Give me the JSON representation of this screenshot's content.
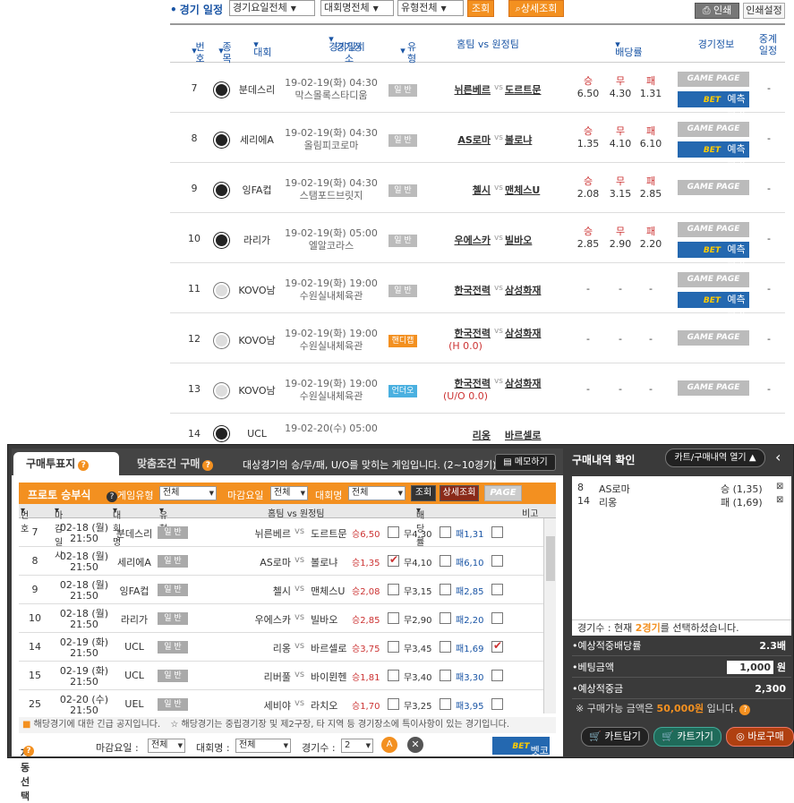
{
  "header": {
    "title": "경기 일정",
    "filters": [
      "경기요일전체",
      "대회명전체",
      "유형전체"
    ],
    "search_btn": "조회",
    "detail_btn": "상세조회",
    "print_btn": "인쇄",
    "print_settings_btn": "인쇄설정"
  },
  "columns": {
    "num": "번호",
    "sport": "종목",
    "league": "대회",
    "datetime": "경기일시",
    "venue": "경기장소",
    "type": "유형",
    "home_vs_away": "홈팀 vs 원정팀",
    "odds": "배당률",
    "info": "경기정보",
    "broadcast": "중계일정"
  },
  "games": [
    {
      "num": "7",
      "league": "분데스리",
      "sport": "soccer",
      "dt": "19-02-19(화) 04:30",
      "venue": "막스몰록스타디움",
      "type": "일 반",
      "type_color": "gray",
      "home": "뉘른베르",
      "away": "도르트문",
      "o1": "6.50",
      "o2": "4.30",
      "o3": "1.31",
      "bet": true,
      "dash": "-"
    },
    {
      "num": "8",
      "league": "세리에A",
      "sport": "soccer",
      "dt": "19-02-19(화) 04:30",
      "venue": "올림피코로마",
      "type": "일 반",
      "type_color": "gray",
      "home": "AS로마",
      "away": "볼로냐",
      "o1": "1.35",
      "o2": "4.10",
      "o3": "6.10",
      "bet": true,
      "dash": "-"
    },
    {
      "num": "9",
      "league": "잉FA컵",
      "sport": "soccer",
      "dt": "19-02-19(화) 04:30",
      "venue": "스탬포드브릿지",
      "type": "일 반",
      "type_color": "gray",
      "home": "첼시",
      "away": "맨체스U",
      "o1": "2.08",
      "o2": "3.15",
      "o3": "2.85",
      "bet": false,
      "dash": "-"
    },
    {
      "num": "10",
      "league": "라리가",
      "sport": "soccer",
      "dt": "19-02-19(화) 05:00",
      "venue": "엘알코라스",
      "type": "일 반",
      "type_color": "gray",
      "home": "우에스카",
      "away": "빌바오",
      "o1": "2.85",
      "o2": "2.90",
      "o3": "2.20",
      "bet": true,
      "dash": "-"
    },
    {
      "num": "11",
      "league": "KOVO남",
      "sport": "volley",
      "dt": "19-02-19(화) 19:00",
      "venue": "수원실내체육관",
      "type": "일 반",
      "type_color": "gray",
      "home": "한국전력",
      "away": "삼성화재",
      "o1": "-",
      "o2": "-",
      "o3": "-",
      "bet": true,
      "dash": "-"
    },
    {
      "num": "12",
      "league": "KOVO남",
      "sport": "volley",
      "dt": "19-02-19(화) 19:00",
      "venue": "수원실내체육관",
      "type": "핸디캡",
      "type_color": "orange",
      "home": "한국전력",
      "away": "삼성화재",
      "extra": "(H 0.0)",
      "o1": "-",
      "o2": "-",
      "o3": "-",
      "bet": false,
      "dash": "-"
    },
    {
      "num": "13",
      "league": "KOVO남",
      "sport": "volley",
      "dt": "19-02-19(화) 19:00",
      "venue": "수원실내체육관",
      "type": "언더오버",
      "type_color": "blue",
      "home": "한국전력",
      "away": "삼성화재",
      "extra": "(U/O 0.0)",
      "o1": "-",
      "o2": "-",
      "o3": "-",
      "bet": false,
      "dash": "-"
    }
  ],
  "partial_row": {
    "num": "14",
    "league": "UCL",
    "dt": "19-02-20(수) 05:00",
    "home": "리옹",
    "away": "바르셀로"
  },
  "odds_labels": {
    "w": "승",
    "d": "무",
    "l": "패"
  },
  "vs": "vs",
  "gamepage": "GAME PAGE",
  "bet_label": "예측하기",
  "bet_tag": "BET",
  "panel": {
    "tab1": "구매투표지",
    "tab2": "맞춤조건 구매",
    "desc": "대상경기의 승/무/패, U/O를 맞히는 게임입니다. (2~10경기)",
    "memo_btn": "메모하기",
    "filter_title": "프로토 승부식",
    "game_type_lbl": "게임유형",
    "game_type_val": "전체",
    "deadline_lbl": "마감요일",
    "deadline_val": "전체",
    "league_lbl": "대회명",
    "league_val": "전체",
    "search_btn": "조회",
    "detail_btn": "상세조회",
    "page_btn": "PAGE",
    "head": {
      "num": "번호",
      "deadline": "마감일시",
      "league": "대회명",
      "type": "유형",
      "teams": "홈팀 vs 원정팀",
      "odds": "배당률",
      "note": "비고"
    },
    "rows": [
      {
        "num": "7",
        "d1": "02-18 (월)",
        "d2": "21:50",
        "league": "분데스리",
        "type": "일 반",
        "home": "뉘른베르",
        "away": "도르트문",
        "w": "승6,50",
        "d": "무4,30",
        "l": "패1,31",
        "cw": false,
        "cd": false,
        "cl": false
      },
      {
        "num": "8",
        "d1": "02-18 (월)",
        "d2": "21:50",
        "league": "세리에A",
        "type": "일 반",
        "home": "AS로마",
        "away": "볼로냐",
        "w": "승1,35",
        "d": "무4,10",
        "l": "패6,10",
        "cw": true,
        "cd": false,
        "cl": false
      },
      {
        "num": "9",
        "d1": "02-18 (월)",
        "d2": "21:50",
        "league": "잉FA컵",
        "type": "일 반",
        "home": "첼시",
        "away": "맨체스U",
        "w": "승2,08",
        "d": "무3,15",
        "l": "패2,85",
        "cw": false,
        "cd": false,
        "cl": false
      },
      {
        "num": "10",
        "d1": "02-18 (월)",
        "d2": "21:50",
        "league": "라리가",
        "type": "일 반",
        "home": "우에스카",
        "away": "빌바오",
        "w": "승2,85",
        "d": "무2,90",
        "l": "패2,20",
        "cw": false,
        "cd": false,
        "cl": false
      },
      {
        "num": "14",
        "d1": "02-19 (화)",
        "d2": "21:50",
        "league": "UCL",
        "type": "일 반",
        "home": "리옹",
        "away": "바르셀로",
        "w": "승3,75",
        "d": "무3,45",
        "l": "패1,69",
        "cw": false,
        "cd": false,
        "cl": true
      },
      {
        "num": "15",
        "d1": "02-19 (화)",
        "d2": "21:50",
        "league": "UCL",
        "type": "일 반",
        "home": "리버풀",
        "away": "바이뮌헨",
        "w": "승1,81",
        "d": "무3,40",
        "l": "패3,30",
        "cw": false,
        "cd": false,
        "cl": false
      },
      {
        "num": "25",
        "d1": "02-20 (수)",
        "d2": "21:50",
        "league": "UEL",
        "type": "일 반",
        "home": "세비야",
        "away": "라치오",
        "w": "승1,70",
        "d": "무3,25",
        "l": "패3,95",
        "cw": false,
        "cd": false,
        "cl": false
      }
    ],
    "notice1": "해당경기에 대한 긴급 공지입니다.",
    "notice2": "해당경기는 중립경기장 및 제2구장, 타 지역 등 경기장소에 특이사항이 있는 경기입니다.",
    "auto_lbl": "자동선택",
    "auto_deadline_lbl": "마감요일 :",
    "auto_deadline_val": "전체",
    "auto_league_lbl": "대회명 :",
    "auto_league_val": "전체",
    "auto_count_lbl": "경기수 :",
    "auto_count_val": "2",
    "bet_btn": "벳코치",
    "right": {
      "title": "구매내역 확인",
      "cart_btn": "카트/구매내역 열기",
      "items": [
        {
          "num": "8",
          "team": "AS로마",
          "odd": "승 (1,35)"
        },
        {
          "num": "14",
          "team": "리옹",
          "odd": "패 (1,69)"
        }
      ],
      "count_text1": "경기수 : 현재 ",
      "count_val": "2경기",
      "count_text2": "를 선택하셨습니다.",
      "exp_odds_lbl": "•예상적중배당률",
      "exp_odds_val": "2.3배",
      "bet_amt_lbl": "•베팅금액",
      "bet_amt_val": "1,000",
      "won": "원",
      "exp_win_lbl": "•예상적중금",
      "exp_win_val": "2,300",
      "note1": "※ 구매가능 금액은 ",
      "note_amt": "50,000원",
      "note2": " 입니다.",
      "btn_cart": "카트담기",
      "btn_gocart": "카트가기",
      "btn_buy": "바로구매"
    }
  }
}
